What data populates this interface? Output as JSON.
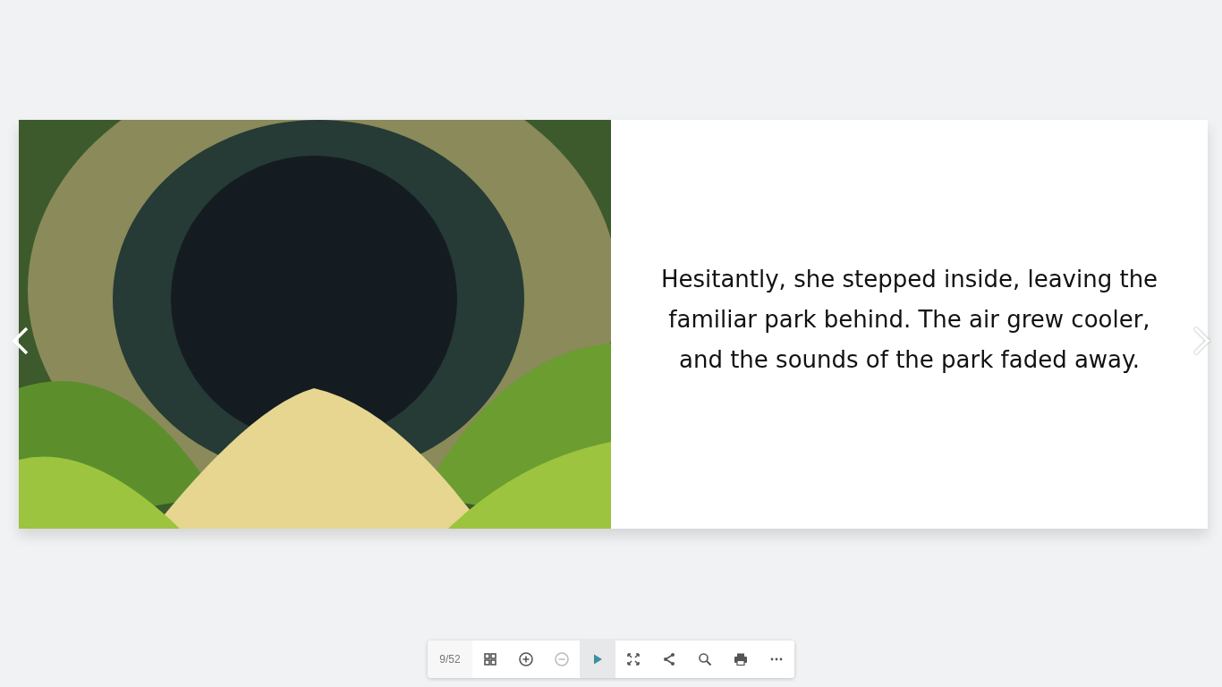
{
  "book": {
    "page_text": "Hesitantly, she stepped inside, leaving the familiar park behind. The air grew cooler, and the sounds of the park faded away."
  },
  "toolbar": {
    "page_counter": "9/52",
    "buttons": [
      {
        "kind": "thumbnails",
        "disabled": false,
        "active": false
      },
      {
        "kind": "zoom-in",
        "disabled": false,
        "active": false
      },
      {
        "kind": "zoom-out",
        "disabled": true,
        "active": false
      },
      {
        "kind": "play",
        "disabled": false,
        "active": true
      },
      {
        "kind": "fullscreen",
        "disabled": false,
        "active": false
      },
      {
        "kind": "share",
        "disabled": false,
        "active": false
      },
      {
        "kind": "search",
        "disabled": false,
        "active": false
      },
      {
        "kind": "print",
        "disabled": false,
        "active": false
      },
      {
        "kind": "more",
        "disabled": false,
        "active": false
      }
    ]
  }
}
